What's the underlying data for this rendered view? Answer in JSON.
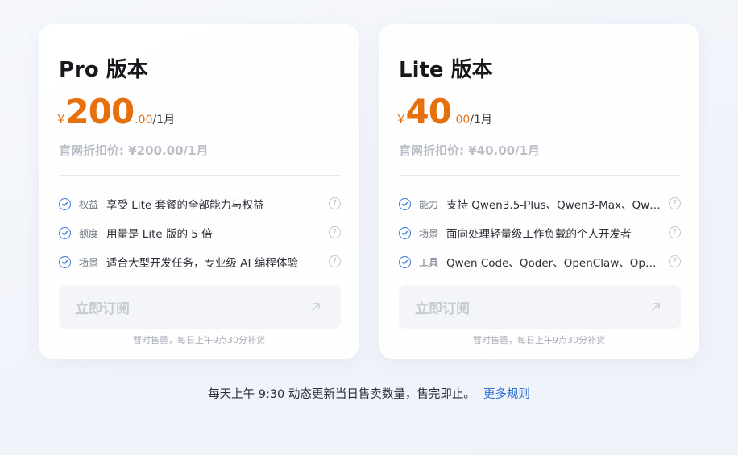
{
  "plans": [
    {
      "title": "Pro 版本",
      "price": {
        "currency": "¥",
        "integer": "200",
        "decimal": ".00",
        "unit": "/1月"
      },
      "official_price": "官网折扣价: ¥200.00/1月",
      "features": [
        {
          "tag": "权益",
          "text": "享受 Lite 套餐的全部能力与权益",
          "help": "?"
        },
        {
          "tag": "额度",
          "text": "用量是 Lite 版的 5 倍",
          "help": "?"
        },
        {
          "tag": "场景",
          "text": "适合大型开发任务，专业级 AI 编程体验",
          "help": "?"
        }
      ],
      "button_label": "立即订阅",
      "sold_out_note": "暂时售罄，每日上午9点30分补货"
    },
    {
      "title": "Lite 版本",
      "price": {
        "currency": "¥",
        "integer": "40",
        "decimal": ".00",
        "unit": "/1月"
      },
      "official_price": "官网折扣价: ¥40.00/1月",
      "features": [
        {
          "tag": "能力",
          "text": "支持 Qwen3.5-Plus、Qwen3-Max、Qw…",
          "help": "?"
        },
        {
          "tag": "场景",
          "text": "面向处理轻量级工作负载的个人开发者",
          "help": "?"
        },
        {
          "tag": "工具",
          "text": "Qwen Code、Qoder、OpenClaw、Op…",
          "help": "?"
        }
      ],
      "button_label": "立即订阅",
      "sold_out_note": "暂时售罄，每日上午9点30分补货"
    }
  ],
  "footer": {
    "text": "每天上午 9:30 动态更新当日售卖数量，售完即止。",
    "link_label": "更多规则"
  },
  "icons": {
    "check": "check-circle-icon",
    "help": "question-circle-icon",
    "arrow": "arrow-up-right-icon"
  },
  "colors": {
    "price": "#e6700e",
    "check": "#3e7bd8",
    "link": "#2f6fd3",
    "disabled_text": "#c6cbd3"
  }
}
